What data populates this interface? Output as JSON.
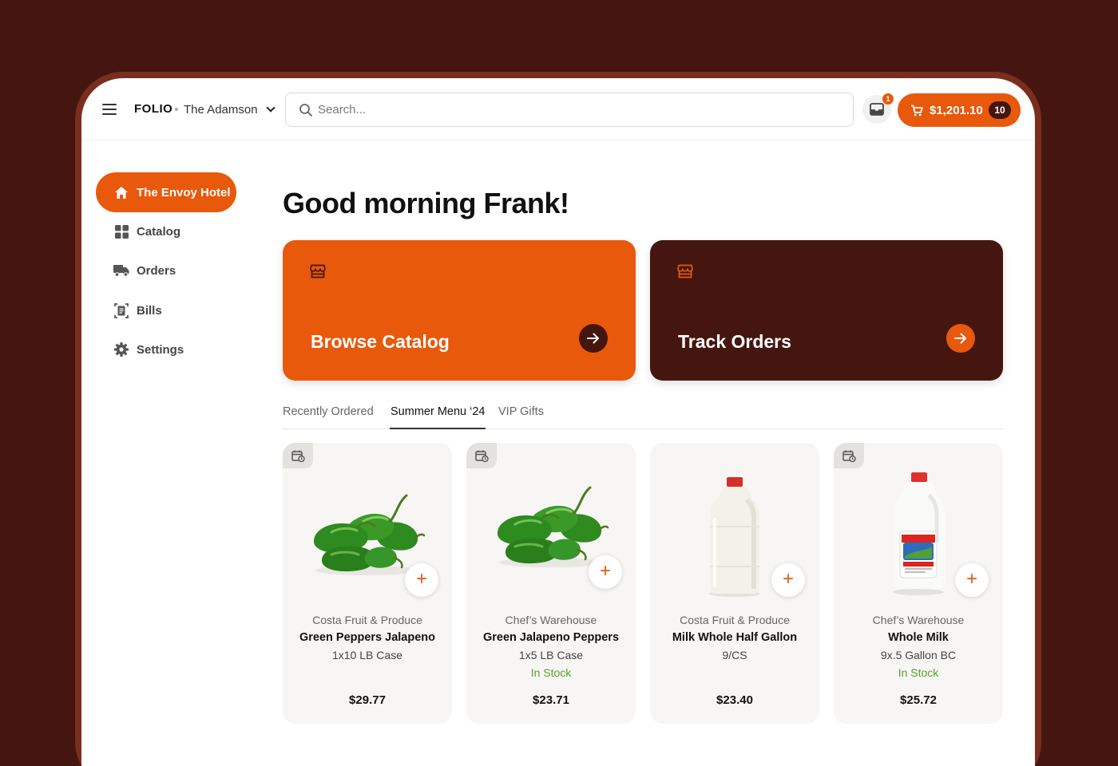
{
  "header": {
    "brand": "FOLIO",
    "organization": "The Adamson",
    "search_placeholder": "Search...",
    "inbox_badge": "1",
    "cart_total": "$1,201.10",
    "cart_count": "10"
  },
  "sidebar": {
    "items": [
      {
        "label": "The Envoy Hotel",
        "icon": "home-icon",
        "active": true
      },
      {
        "label": "Catalog",
        "icon": "grid-icon",
        "active": false
      },
      {
        "label": "Orders",
        "icon": "truck-icon",
        "active": false
      },
      {
        "label": "Bills",
        "icon": "receipt-icon",
        "active": false
      },
      {
        "label": "Settings",
        "icon": "gear-icon",
        "active": false
      }
    ]
  },
  "main": {
    "greeting": "Good morning Frank!",
    "cards": [
      {
        "title": "Browse Catalog",
        "icon": "store-icon"
      },
      {
        "title": "Track Orders",
        "icon": "store-icon"
      }
    ],
    "tabs": [
      {
        "label": "Recently Ordered",
        "active": false
      },
      {
        "label": "Summer Menu ‘24",
        "active": true
      },
      {
        "label": "VIP Gifts",
        "active": false
      }
    ],
    "products": [
      {
        "vendor": "Costa Fruit & Produce",
        "name": "Green Peppers Jalapeno",
        "pack": "1x10 LB Case",
        "stock": "",
        "price": "$29.77",
        "recurring": true,
        "image": "jalapeno-peppers"
      },
      {
        "vendor": "Chef’s Warehouse",
        "name": "Green Jalapeno Peppers",
        "pack": "1x5 LB Case",
        "stock": "In Stock",
        "price": "$23.71",
        "recurring": true,
        "image": "jalapeno-peppers"
      },
      {
        "vendor": "Costa Fruit & Produce",
        "name": "Milk Whole Half Gallon",
        "pack": "9/CS",
        "stock": "",
        "price": "$23.40",
        "recurring": false,
        "image": "milk-jug-plain"
      },
      {
        "vendor": "Chef’s Warehouse",
        "name": "Whole Milk",
        "pack": "9x.5 Gallon BC",
        "stock": "In Stock",
        "price": "$25.72",
        "recurring": true,
        "image": "milk-jug-labeled"
      }
    ]
  },
  "colors": {
    "accent": "#e8590c",
    "dark": "#45160f",
    "in_stock": "#52a32b"
  }
}
